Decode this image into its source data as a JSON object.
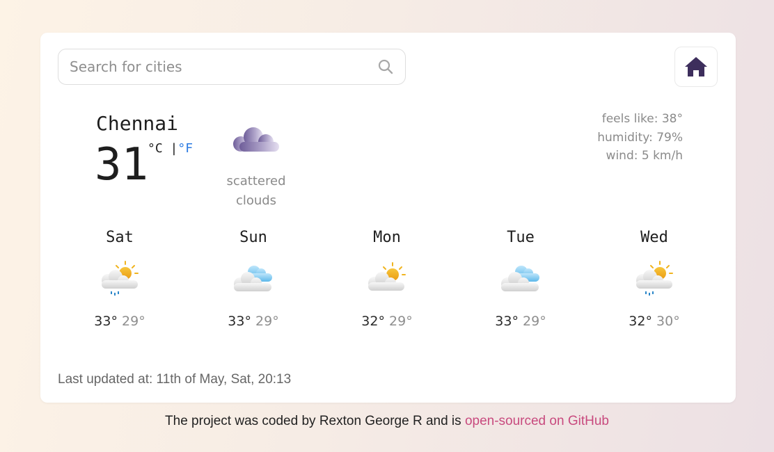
{
  "search": {
    "placeholder": "Search for cities",
    "value": ""
  },
  "current": {
    "city": "Chennai",
    "temp": "31",
    "unit_c": "°C",
    "unit_sep": " |",
    "unit_f": "°F",
    "condition_line1": "scattered",
    "condition_line2": "clouds",
    "icon": "cloud-icon"
  },
  "stats": {
    "feels_like": "feels like: 38°",
    "humidity": "humidity: 79%",
    "wind": "wind: 5 km/h"
  },
  "forecast": [
    {
      "day": "Sat",
      "max": "33°",
      "min": "29°",
      "icon": "sun-cloud-rain-icon"
    },
    {
      "day": "Sun",
      "max": "33°",
      "min": "29°",
      "icon": "cloudy-icon"
    },
    {
      "day": "Mon",
      "max": "32°",
      "min": "29°",
      "icon": "sun-cloud-icon"
    },
    {
      "day": "Tue",
      "max": "33°",
      "min": "29°",
      "icon": "cloudy-icon"
    },
    {
      "day": "Wed",
      "max": "32°",
      "min": "30°",
      "icon": "sun-cloud-rain-icon"
    }
  ],
  "last_updated": "Last updated at: 11th of May, Sat, 20:13",
  "footer": {
    "text": "The project was coded by Rexton George R and is ",
    "link_text": "open-sourced on GitHub"
  },
  "colors": {
    "accent_blue": "#2a7ae2",
    "link_pink": "#c84a7e",
    "home_icon": "#3d2e5c"
  }
}
